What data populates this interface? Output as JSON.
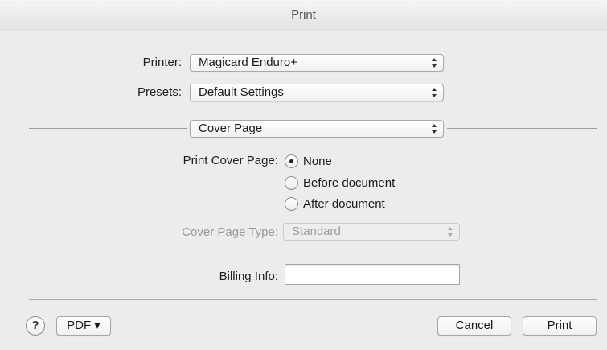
{
  "window": {
    "title": "Print"
  },
  "printer": {
    "label": "Printer:",
    "value": "Magicard Enduro+"
  },
  "presets": {
    "label": "Presets:",
    "value": "Default Settings"
  },
  "panel": {
    "value": "Cover Page"
  },
  "cover_page": {
    "label": "Print Cover Page:",
    "options": [
      {
        "label": "None",
        "selected": true
      },
      {
        "label": "Before document",
        "selected": false
      },
      {
        "label": "After document",
        "selected": false
      }
    ]
  },
  "cover_page_type": {
    "label": "Cover Page Type:",
    "value": "Standard",
    "enabled": false
  },
  "billing_info": {
    "label": "Billing Info:",
    "value": ""
  },
  "footer": {
    "help_glyph": "?",
    "pdf_label": "PDF ▾",
    "cancel_label": "Cancel",
    "print_label": "Print"
  }
}
